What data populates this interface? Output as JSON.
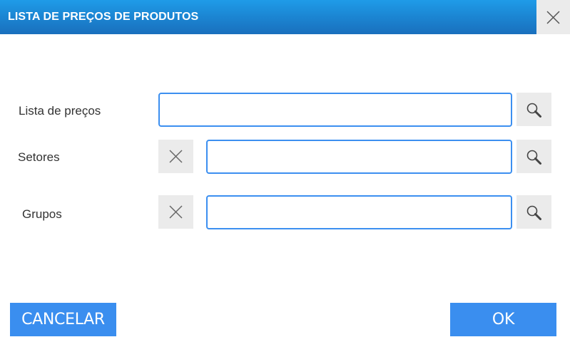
{
  "dialog": {
    "title": "LISTA DE PREÇOS DE PRODUTOS"
  },
  "fields": {
    "price_list": {
      "label": "Lista de preços",
      "value": "",
      "placeholder": ""
    },
    "sectors": {
      "label": "Setores",
      "value": "",
      "placeholder": ""
    },
    "groups": {
      "label": "Grupos",
      "value": "",
      "placeholder": ""
    }
  },
  "buttons": {
    "cancel_label": "CANCELAR",
    "ok_label": "OK"
  },
  "icons": {
    "close": "close-icon",
    "search": "search-icon",
    "clear": "clear-icon"
  },
  "colors": {
    "titlebar": "#1b85d2",
    "accent": "#3a8eef",
    "input_border": "#3c8ff0",
    "icon_button_bg": "#ebebeb"
  }
}
